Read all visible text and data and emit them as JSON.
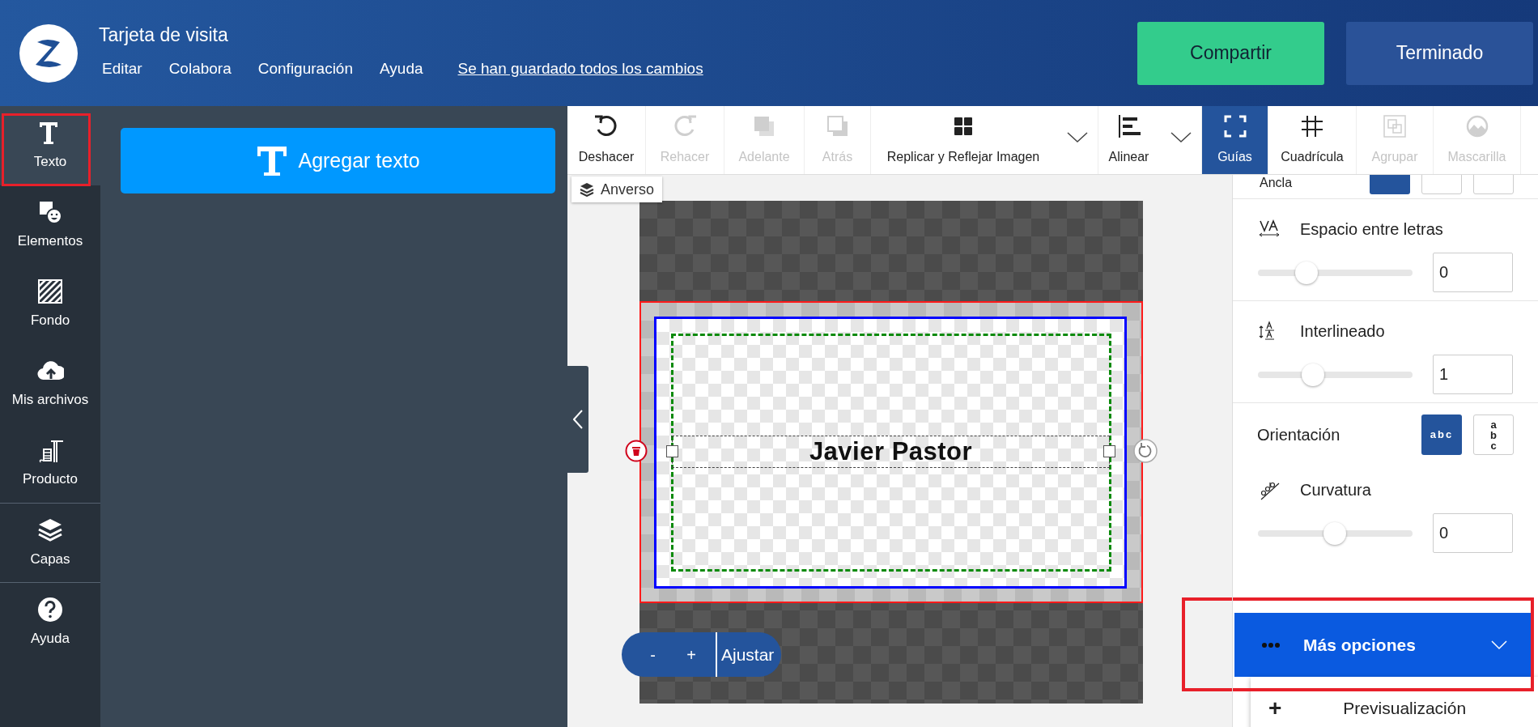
{
  "header": {
    "title": "Tarjeta de visita",
    "menu": [
      "Editar",
      "Colabora",
      "Configuración",
      "Ayuda"
    ],
    "save_status": "Se han guardado todos los cambios",
    "buttons": [
      {
        "label": "Compartir",
        "kind": "primary"
      },
      {
        "label": "Terminado",
        "kind": "secondary"
      }
    ]
  },
  "sidebar": {
    "items": [
      {
        "label": "Texto",
        "selected": true,
        "highlighted": true
      },
      {
        "label": "Elementos",
        "selected": false,
        "highlighted": false
      },
      {
        "label": "Fondo",
        "selected": false,
        "highlighted": false
      },
      {
        "label": "Mis archivos",
        "selected": false,
        "highlighted": false
      },
      {
        "label": "Producto",
        "selected": false,
        "highlighted": false
      },
      {
        "label": "Capas",
        "selected": false,
        "highlighted": false
      },
      {
        "label": "Ayuda",
        "selected": false,
        "highlighted": false
      }
    ]
  },
  "panel": {
    "add_text_button": "Agregar texto"
  },
  "toolbar": {
    "items": [
      {
        "label": "Deshacer",
        "disabled": false,
        "selected": false,
        "dropdown": false
      },
      {
        "label": "Rehacer",
        "disabled": true,
        "selected": false,
        "dropdown": false
      },
      {
        "label": "Adelante",
        "disabled": true,
        "selected": false,
        "dropdown": false
      },
      {
        "label": "Atrás",
        "disabled": true,
        "selected": false,
        "dropdown": false
      },
      {
        "label": "Replicar y Reflejar Imagen",
        "disabled": false,
        "selected": false,
        "dropdown": true
      },
      {
        "label": "Alinear",
        "disabled": false,
        "selected": false,
        "dropdown": true
      },
      {
        "label": "Guías",
        "disabled": false,
        "selected": true,
        "dropdown": false
      },
      {
        "label": "Cuadrícula",
        "disabled": false,
        "selected": false,
        "dropdown": false
      },
      {
        "label": "Agrupar",
        "disabled": true,
        "selected": false,
        "dropdown": false
      },
      {
        "label": "Mascarilla",
        "disabled": true,
        "selected": false,
        "dropdown": false
      }
    ]
  },
  "canvas": {
    "side_label": "Anverso",
    "text": "Javier Pastor",
    "zoom": {
      "minus": "-",
      "plus": "+",
      "fit": "Ajustar"
    }
  },
  "properties": {
    "anchor": {
      "label": "Ancla",
      "options": [
        {
          "selected": true
        },
        {
          "selected": false
        },
        {
          "selected": false
        }
      ]
    },
    "rows": [
      {
        "kind": "slider",
        "label": "Espacio entre letras",
        "level": 0.28,
        "value": "0"
      },
      {
        "kind": "slider",
        "label": "Interlineado",
        "level": 0.33,
        "value": "1"
      },
      {
        "kind": "orientation",
        "label": "Orientación",
        "options": [
          {
            "label": "abc",
            "selected": true,
            "vertical": false
          },
          {
            "label": "abc",
            "selected": false,
            "vertical": true
          }
        ]
      },
      {
        "kind": "slider",
        "label": "Curvatura",
        "level": 0.49,
        "value": "0"
      }
    ],
    "more_options": {
      "label": "Más opciones",
      "highlighted": true
    },
    "preview": {
      "icon": "+",
      "label": "Previsualización"
    }
  }
}
